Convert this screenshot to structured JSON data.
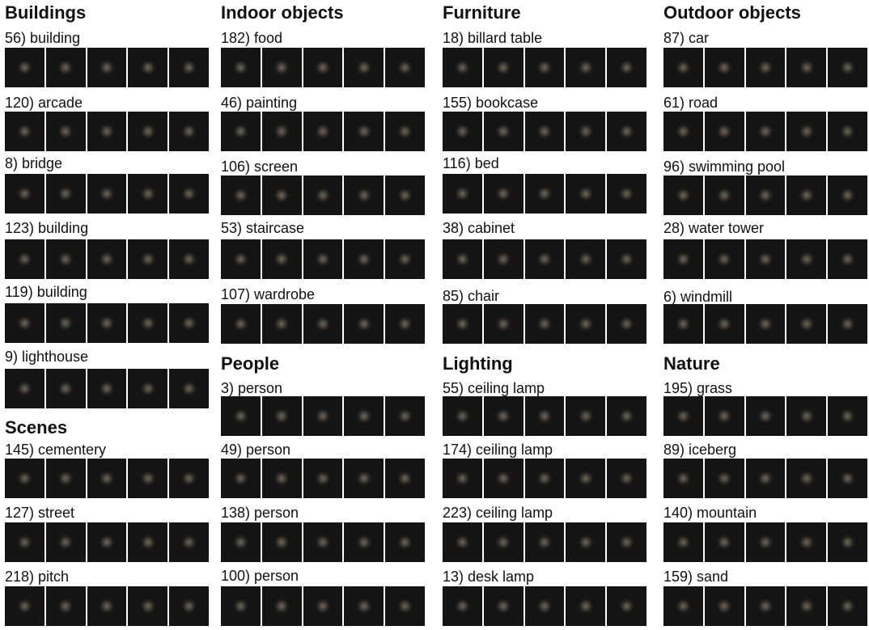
{
  "columns": [
    {
      "blocks": [
        {
          "type": "heading",
          "text": "Buildings"
        },
        {
          "type": "item",
          "label": "56) building"
        },
        {
          "type": "item",
          "label": "120) arcade"
        },
        {
          "type": "item",
          "label": "8) bridge"
        },
        {
          "type": "item",
          "label": "123) building"
        },
        {
          "type": "item",
          "label": "119) building"
        },
        {
          "type": "item",
          "label": "9) lighthouse"
        },
        {
          "type": "heading",
          "text": "Scenes"
        },
        {
          "type": "item",
          "label": "145) cementery"
        },
        {
          "type": "item",
          "label": "127) street"
        },
        {
          "type": "item",
          "label": "218) pitch"
        }
      ]
    },
    {
      "blocks": [
        {
          "type": "heading",
          "text": "Indoor objects"
        },
        {
          "type": "item",
          "label": "182) food"
        },
        {
          "type": "item",
          "label": "46) painting"
        },
        {
          "type": "item",
          "label": "106) screen"
        },
        {
          "type": "item",
          "label": "53) staircase"
        },
        {
          "type": "item",
          "label": "107) wardrobe"
        },
        {
          "type": "heading",
          "text": "People"
        },
        {
          "type": "item",
          "label": "3) person"
        },
        {
          "type": "item",
          "label": "49) person"
        },
        {
          "type": "item",
          "label": "138) person"
        },
        {
          "type": "item",
          "label": "100) person"
        }
      ]
    },
    {
      "blocks": [
        {
          "type": "heading",
          "text": "Furniture"
        },
        {
          "type": "item",
          "label": "18) billard table"
        },
        {
          "type": "item",
          "label": "155) bookcase"
        },
        {
          "type": "item",
          "label": "116) bed"
        },
        {
          "type": "item",
          "label": "38) cabinet"
        },
        {
          "type": "item",
          "label": "85) chair"
        },
        {
          "type": "heading",
          "text": "Lighting"
        },
        {
          "type": "item",
          "label": "55) ceiling lamp"
        },
        {
          "type": "item",
          "label": "174) ceiling lamp"
        },
        {
          "type": "item",
          "label": "223) ceiling lamp"
        },
        {
          "type": "item",
          "label": "13) desk lamp"
        }
      ]
    },
    {
      "blocks": [
        {
          "type": "heading",
          "text": "Outdoor objects"
        },
        {
          "type": "item",
          "label": "87) car"
        },
        {
          "type": "item",
          "label": "61) road"
        },
        {
          "type": "item",
          "label": "96) swimming pool"
        },
        {
          "type": "item",
          "label": "28) water tower"
        },
        {
          "type": "item",
          "label": "6) windmill"
        },
        {
          "type": "heading",
          "text": "Nature"
        },
        {
          "type": "item",
          "label": "195) grass"
        },
        {
          "type": "item",
          "label": "89) iceberg"
        },
        {
          "type": "item",
          "label": "140) mountain"
        },
        {
          "type": "item",
          "label": "159) sand"
        }
      ]
    }
  ]
}
